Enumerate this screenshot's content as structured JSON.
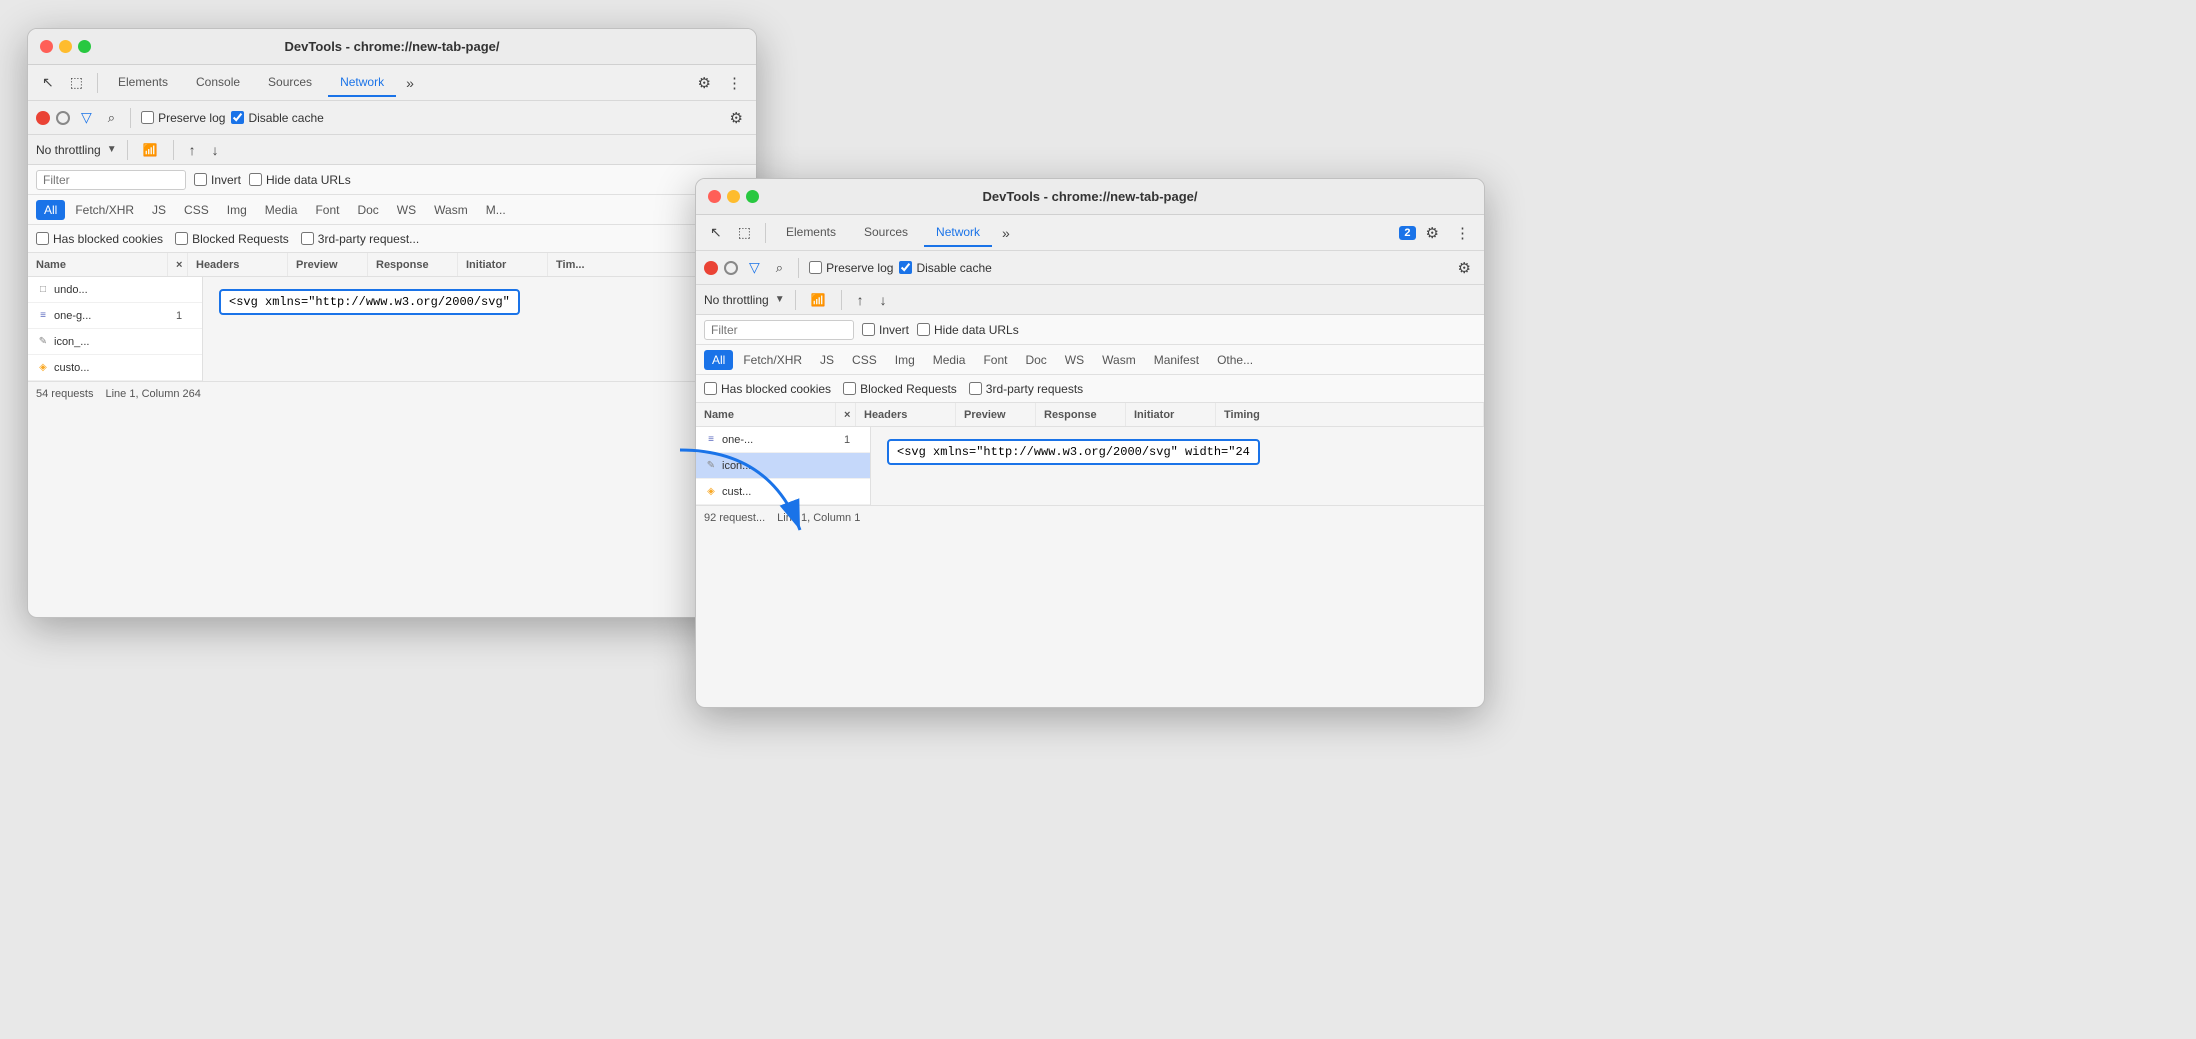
{
  "window1": {
    "title": "DevTools - chrome://new-tab-page/",
    "tabs": [
      "Elements",
      "Console",
      "Sources",
      "Network"
    ],
    "active_tab": "Network",
    "action_bar": {
      "preserve_log": "Preserve log",
      "disable_cache": "Disable cache"
    },
    "throttle": {
      "label": "No throttling",
      "dropdown_symbol": "▼"
    },
    "filter": {
      "placeholder": "Filter",
      "invert": "Invert",
      "hide_data_urls": "Hide data URLs"
    },
    "type_tabs": [
      "All",
      "Fetch/XHR",
      "JS",
      "CSS",
      "Img",
      "Media",
      "Font",
      "Doc",
      "WS",
      "Wasm",
      "M..."
    ],
    "active_type": "All",
    "checkboxes": {
      "blocked_cookies": "Has blocked cookies",
      "blocked_requests": "Blocked Requests",
      "third_party": "3rd-party request..."
    },
    "table": {
      "headers": [
        "Name",
        "×",
        "Headers",
        "Preview",
        "Response",
        "Initiator",
        "Tim..."
      ],
      "rows": [
        {
          "icon": "unknown",
          "name": "undo...",
          "number": "",
          "selected": false
        },
        {
          "icon": "svg",
          "name": "one-g...",
          "number": "1",
          "selected": false
        },
        {
          "icon": "js",
          "name": "icon_...",
          "number": "",
          "selected": false
        },
        {
          "icon": "js-yellow",
          "name": "custo...",
          "number": "",
          "selected": false
        }
      ]
    },
    "response_preview": "<svg xmlns=\"http://www.w3.org/2000/svg\"",
    "status_bar": {
      "requests": "54 requests",
      "position": "Line 1, Column 264"
    }
  },
  "window2": {
    "title": "DevTools - chrome://new-tab-page/",
    "tabs": [
      "Elements",
      "Sources",
      "Network"
    ],
    "active_tab": "Network",
    "badge": "2",
    "action_bar": {
      "preserve_log": "Preserve log",
      "disable_cache": "Disable cache"
    },
    "throttle": {
      "label": "No throttling",
      "dropdown_symbol": "▼"
    },
    "filter": {
      "placeholder": "Filter",
      "invert": "Invert",
      "hide_data_urls": "Hide data URLs"
    },
    "type_tabs": [
      "All",
      "Fetch/XHR",
      "JS",
      "CSS",
      "Img",
      "Media",
      "Font",
      "Doc",
      "WS",
      "Wasm",
      "Manifest",
      "Othe..."
    ],
    "active_type": "All",
    "checkboxes": {
      "blocked_cookies": "Has blocked cookies",
      "blocked_requests": "Blocked Requests",
      "third_party": "3rd-party requests"
    },
    "table": {
      "headers": [
        "Name",
        "×",
        "Headers",
        "Preview",
        "Response",
        "Initiator",
        "Timing"
      ],
      "rows": [
        {
          "icon": "svg",
          "name": "one-...",
          "number": "1",
          "selected": false
        },
        {
          "icon": "js",
          "name": "icon...",
          "number": "",
          "selected": true
        },
        {
          "icon": "js-yellow",
          "name": "cust...",
          "number": "",
          "selected": false
        }
      ]
    },
    "response_preview": "<svg xmlns=\"http://www.w3.org/2000/svg\" width=\"24",
    "status_bar": {
      "requests": "92 request...",
      "position": "Line 1, Column 1"
    }
  },
  "icons": {
    "close": "●",
    "min": "●",
    "max": "●",
    "gear": "⚙",
    "more": "⋮",
    "more_tools": "≫",
    "cursor": "↖",
    "inspector": "⬚",
    "record_stop": "⊘",
    "filter": "▽",
    "search": "⌕",
    "upload": "↑",
    "download": "↓",
    "wifi": "((•))"
  }
}
